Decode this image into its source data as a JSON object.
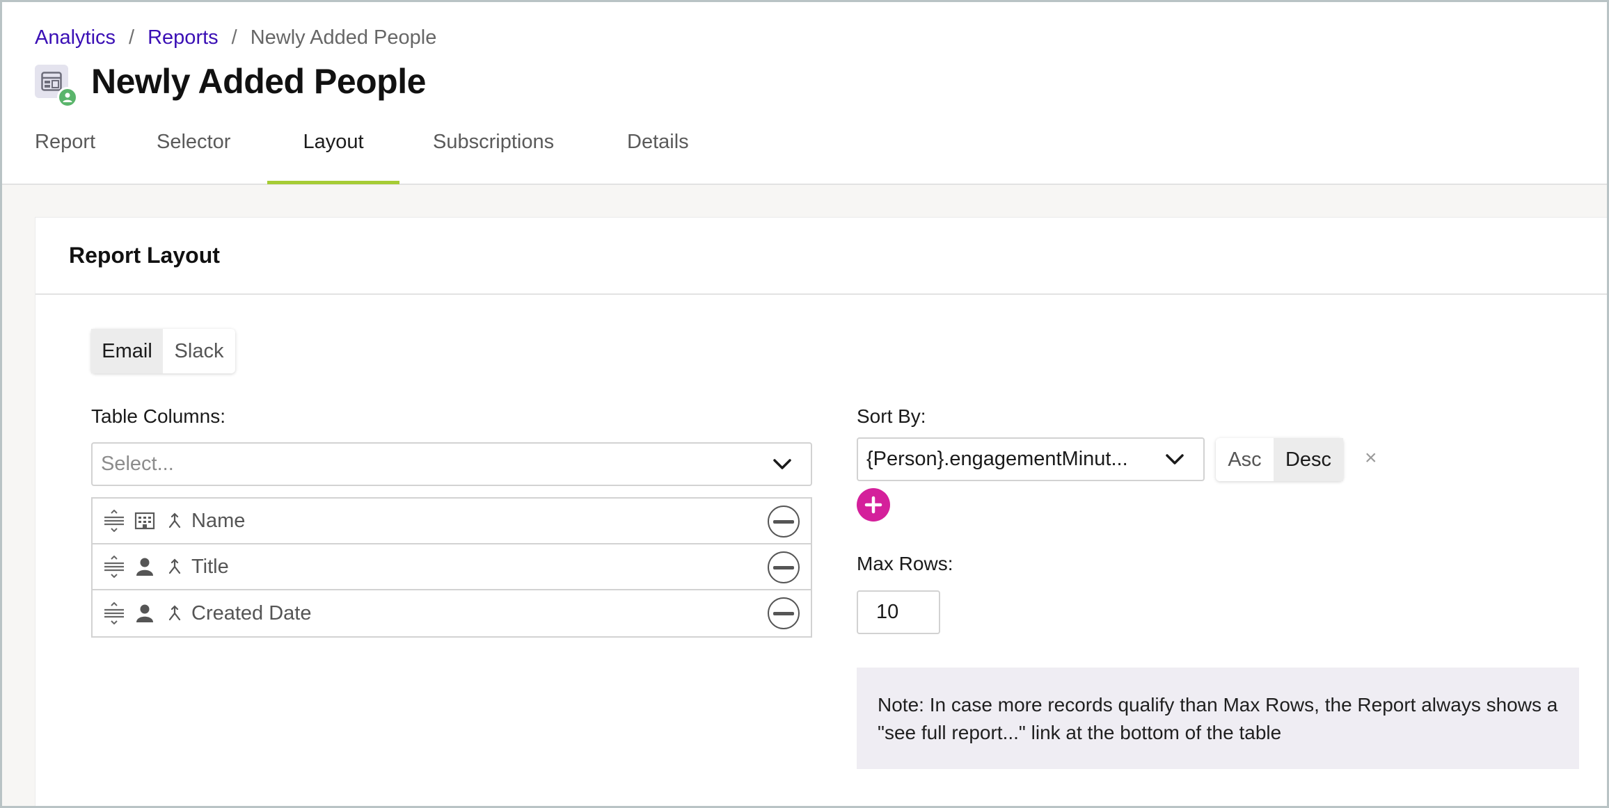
{
  "breadcrumb": {
    "items": [
      {
        "label": "Analytics"
      },
      {
        "label": "Reports"
      }
    ],
    "current": "Newly Added People",
    "separator": "/"
  },
  "page": {
    "title": "Newly Added People"
  },
  "tabs": [
    {
      "label": "Report",
      "active": false
    },
    {
      "label": "Selector",
      "active": false
    },
    {
      "label": "Layout",
      "active": true
    },
    {
      "label": "Subscriptions",
      "active": false
    },
    {
      "label": "Details",
      "active": false
    }
  ],
  "panel": {
    "title": "Report Layout"
  },
  "channel_toggle": {
    "options": [
      "Email",
      "Slack"
    ],
    "selected": "Email"
  },
  "table_columns": {
    "label": "Table Columns:",
    "placeholder": "Select...",
    "columns": [
      {
        "name": "Name",
        "type_icon": "building-icon"
      },
      {
        "name": "Title",
        "type_icon": "person-icon"
      },
      {
        "name": "Created Date",
        "type_icon": "person-icon"
      }
    ]
  },
  "sort": {
    "label": "Sort By:",
    "value": "{Person}.engagementMinut...",
    "order_options": [
      "Asc",
      "Desc"
    ],
    "order_selected": "Desc",
    "remove_symbol": "×"
  },
  "max_rows": {
    "label": "Max Rows:",
    "value": "10"
  },
  "note": {
    "text": "Note: In case more records qualify than Max Rows, the Report always shows a \"see full report...\" link at the bottom of the table"
  },
  "colors": {
    "link": "#3a0fb5",
    "tab_underline": "#a6cc35",
    "add_button": "#d4209b",
    "status_badge": "#5ab56b",
    "note_background": "#efedf3"
  }
}
